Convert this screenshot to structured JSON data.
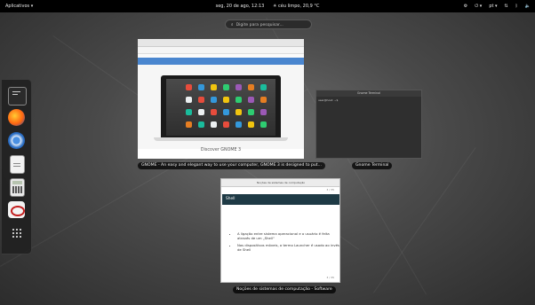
{
  "topbar": {
    "activities_label": "Aplicativos ▾",
    "clock": "seg, 20 de ago, 12:13",
    "weather": "céu limpo, 20,9 °C",
    "tray": {
      "lang": "pt ▾",
      "icons": [
        "settings-icon",
        "power-menu-icon",
        "network-icon",
        "bluetooth-icon",
        "volume-icon"
      ]
    }
  },
  "search": {
    "placeholder": "Digite para pesquisar..."
  },
  "dash": {
    "apps": [
      "terminal-icon",
      "firefox-icon",
      "chromium-icon",
      "document-viewer-icon",
      "calculator-icon",
      "evince-icon",
      "show-apps-icon"
    ]
  },
  "windows": {
    "firefox": {
      "caption": "GNOME - An easy and elegant way to use your computer, GNOME 3 is designed to put...",
      "page_heading": "Discover GNOME 3"
    },
    "terminal": {
      "caption": "Gnome Terminal",
      "title": "Gnome Terminal",
      "prompt": "user@host: ~$"
    },
    "pdf": {
      "caption": "Noções de sistemas de computação - Software",
      "toolbar_title": "Noções de sistemas de computação",
      "page_label_top": "3 / 35",
      "heading": "Shell",
      "bullets": [
        "A ligação entre sistema operacional e o usuário é feita através de um „Shell“",
        "Nos dispositivos móveis, o termo Launcher é usado ao invés de Shell"
      ],
      "page_label_bottom": "3 / 35"
    }
  },
  "colors": {
    "topbar": "#000000",
    "pdf_header": "#1e3a45",
    "ff_nav": "#4a86cf"
  }
}
